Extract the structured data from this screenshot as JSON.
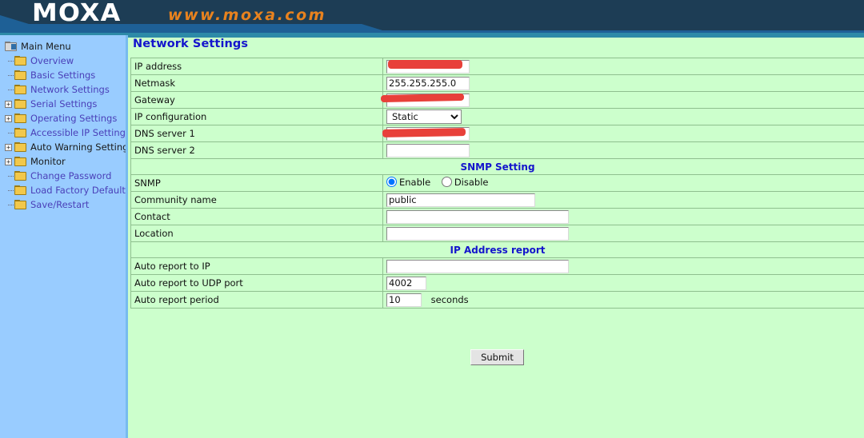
{
  "header": {
    "logo_text": "MOXA",
    "site_url": "www.moxa.com"
  },
  "sidebar": {
    "root": {
      "label": "Main Menu",
      "icon": "root-folder-icon"
    },
    "items": [
      {
        "label": "Overview",
        "icon": "folder-icon",
        "expandable": false,
        "style": "link"
      },
      {
        "label": "Basic Settings",
        "icon": "folder-icon",
        "expandable": false,
        "style": "link"
      },
      {
        "label": "Network Settings",
        "icon": "folder-icon",
        "expandable": false,
        "style": "link"
      },
      {
        "label": "Serial Settings",
        "icon": "folder-icon",
        "expandable": true,
        "style": "link",
        "expander": "+"
      },
      {
        "label": "Operating Settings",
        "icon": "folder-icon",
        "expandable": true,
        "style": "link",
        "expander": "+"
      },
      {
        "label": "Accessible IP Settings",
        "icon": "folder-icon",
        "expandable": false,
        "style": "link"
      },
      {
        "label": "Auto Warning Settings",
        "icon": "folder-icon",
        "expandable": true,
        "style": "plain",
        "expander": "+"
      },
      {
        "label": "Monitor",
        "icon": "folder-icon",
        "expandable": true,
        "style": "plain",
        "expander": "+"
      },
      {
        "label": "Change Password",
        "icon": "folder-icon",
        "expandable": false,
        "style": "link"
      },
      {
        "label": "Load Factory Default",
        "icon": "folder-icon",
        "expandable": false,
        "style": "link"
      },
      {
        "label": "Save/Restart",
        "icon": "folder-icon",
        "expandable": false,
        "style": "link"
      }
    ]
  },
  "main": {
    "page_title": "Network Settings",
    "network": {
      "ip_address_label": "IP address",
      "ip_address_value": "",
      "ip_address_redacted": true,
      "netmask_label": "Netmask",
      "netmask_value": "255.255.255.0",
      "gateway_label": "Gateway",
      "gateway_value": "",
      "gateway_redacted": true,
      "ip_config_label": "IP configuration",
      "ip_config_value": "Static",
      "ip_config_options": [
        "Static"
      ],
      "dns1_label": "DNS server 1",
      "dns1_value": "",
      "dns1_redacted": true,
      "dns2_label": "DNS server 2",
      "dns2_value": ""
    },
    "snmp": {
      "section_title": "SNMP Setting",
      "snmp_label": "SNMP",
      "enable_label": "Enable",
      "disable_label": "Disable",
      "snmp_selected": "Enable",
      "community_label": "Community name",
      "community_value": "public",
      "contact_label": "Contact",
      "contact_value": "",
      "location_label": "Location",
      "location_value": ""
    },
    "ip_report": {
      "section_title": "IP Address report",
      "auto_report_ip_label": "Auto report to IP",
      "auto_report_ip_value": "",
      "auto_report_port_label": "Auto report to UDP port",
      "auto_report_port_value": "4002",
      "auto_report_period_label": "Auto report period",
      "auto_report_period_value": "10",
      "auto_report_period_unit": "seconds"
    },
    "submit_label": "Submit"
  },
  "colors": {
    "header_navy": "#1d3d55",
    "header_steel": "#1e6096",
    "accent_orange": "#e8821e",
    "sidebar_blue": "#99ccff",
    "content_green": "#ccffcc",
    "title_blue": "#1414cc",
    "link_purple": "#4a3fb8",
    "redaction_red": "#e8403a"
  }
}
